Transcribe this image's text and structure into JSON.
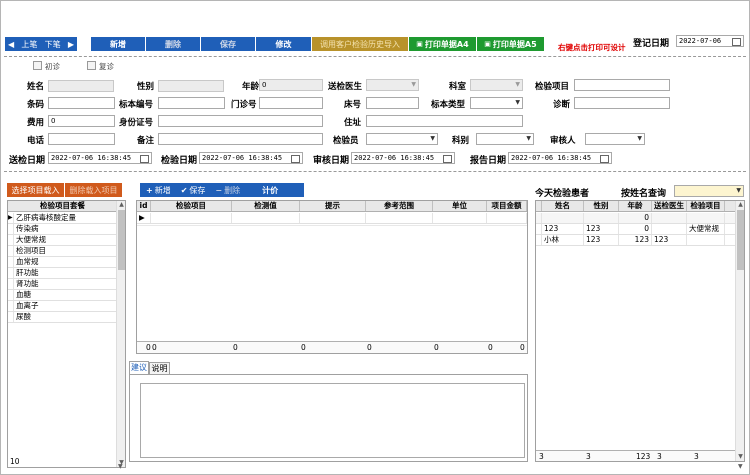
{
  "toolbar": {
    "prev": "上笔",
    "next": "下笔",
    "new": "新增",
    "delete": "删除",
    "save": "保存",
    "modify": "修改",
    "history_import": "调用客户检验历史导入",
    "print_a4": "打印单据A4",
    "print_a5": "打印单据A5",
    "print_hint": "右键点击打印可设计",
    "reg_date_label": "登记日期",
    "reg_date_value": "2022-07-06"
  },
  "checks": {
    "first": "初诊",
    "second": "复诊"
  },
  "form": {
    "name": "姓名",
    "gender": "性别",
    "age": "年龄",
    "age_value": "0",
    "doctor": "送检医生",
    "dept": "科室",
    "test_item": "检验项目",
    "barcode": "条码",
    "specimen_no": "标本编号",
    "clinic_no": "门诊号",
    "bed_no": "床号",
    "specimen_type": "标本类型",
    "diagnosis": "诊断",
    "fee": "费用",
    "fee_value": "0",
    "id_card": "身份证号",
    "address": "住址",
    "phone": "电话",
    "remark": "备注",
    "inspector": "检验员",
    "category": "科别",
    "reviewer": "审核人",
    "send_date": "送检日期",
    "send_date_value": "2022-07-06 16:38:45",
    "test_date": "检验日期",
    "test_date_value": "2022-07-06 16:38:45",
    "review_date": "审核日期",
    "review_date_value": "2022-07-06 16:38:45",
    "report_date": "报告日期",
    "report_date_value": "2022-07-06 16:38:45"
  },
  "left_panel": {
    "select_load": "选择项目载入",
    "delete_load": "删除载入项目",
    "header": "检验项目套餐",
    "items": [
      "乙肝病毒核酸定量",
      "传染病",
      "大便常规",
      "检测项目",
      "血常规",
      "肝功能",
      "肾功能",
      "血糖",
      "血离子",
      "尿酸"
    ],
    "count": "10"
  },
  "mid_panel": {
    "add": "新增",
    "save": "保存",
    "delete": "删除",
    "calc": "计价",
    "columns": [
      "id",
      "检验项目",
      "检测值",
      "提示",
      "参考范围",
      "单位",
      "项目金额"
    ],
    "sums": [
      "0",
      "0",
      "0",
      "0",
      "0",
      "0",
      "0",
      "0"
    ],
    "tab_suggest": "建议",
    "tab_explain": "说明"
  },
  "right_panel": {
    "title": "今天检验患者",
    "search_label": "按姓名查询",
    "columns": [
      "姓名",
      "性别",
      "年龄",
      "送检医生",
      "检验项目"
    ],
    "rows": [
      [
        "",
        "",
        "0",
        "",
        ""
      ],
      [
        "123",
        "123",
        "0",
        "",
        "大便常规"
      ],
      [
        "小林",
        "123",
        "123",
        "123",
        ""
      ]
    ],
    "footer": [
      "3",
      "3",
      "123",
      "3",
      "3"
    ]
  }
}
